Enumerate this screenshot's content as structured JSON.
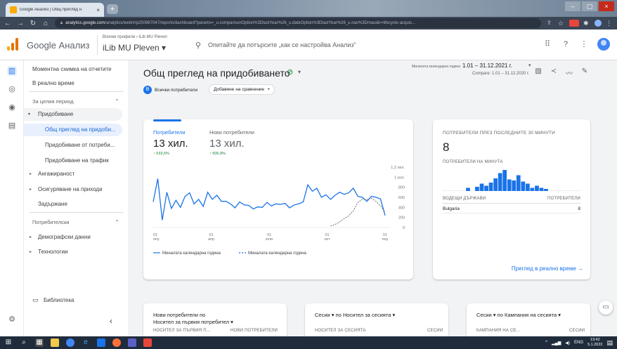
{
  "browser": {
    "tab_title": "Google Анализ | Общ преглед н",
    "tab_close": "×",
    "new_tab": "+",
    "url_host": "analytics.google.com",
    "url_path": "/analytics/web/#/p250987047/reports/dashboard?params=_u.comparisonOption%3DlastYear%26_u.dateOption%3DlastYear%26_u.nav%3Dmaui&r=lifecycle-acquis..."
  },
  "header": {
    "product_name": "Google Анализ",
    "account_breadcrumb": "Всички профили › iLib MU Pleven",
    "property_name": "iLib MU Pleven ▾",
    "search_placeholder": "Опитайте да потърсите „как се настройва Анализ\""
  },
  "sidenav": {
    "snapshot": "Моментна снимка на отчетите",
    "realtime": "В реално време",
    "lifecycle_section": "За целия период",
    "acquisition": "Придобиване",
    "acq_overview": "Общ преглед на придоби...",
    "acq_user": "Придобиване от потреби...",
    "acq_traffic": "Придобиване на трафик",
    "engagement": "Ангажираност",
    "monetization": "Осигуряване на приходи",
    "retention": "Задържане",
    "user_section": "Потребителски",
    "demographics": "Демографски данни",
    "tech": "Технологии",
    "library": "Библиотека"
  },
  "main": {
    "title": "Общ преглед на придобиването",
    "date_label": "Миналата календарна година",
    "date_range": "1.01 – 31.12.2021 г.",
    "date_compare": "Compare: 1.01 – 31.12.2020 г.",
    "chip_all_letter": "В",
    "chip_all": "Всички потребители",
    "chip_add": "Добавяне на сравнение",
    "chip_add_icon": "+"
  },
  "metrics": [
    {
      "label": "Потребители",
      "value": "13 хил.",
      "delta": "↑ 533,5%"
    },
    {
      "label": "Нови потребители",
      "value": "13 хил.",
      "delta": "↑ 506,9%"
    }
  ],
  "chart_data": {
    "type": "line",
    "x_tick_labels": [
      "01\nяну",
      "01\nапр",
      "01\nюли",
      "01\nокт",
      "01\nяну"
    ],
    "y_tick_labels": [
      "1,2 хил.",
      "1 хил.",
      "800",
      "600",
      "400",
      "200",
      "0"
    ],
    "ylim": [
      0,
      1200
    ],
    "series": [
      {
        "name": "Миналата календарна година",
        "style": "solid",
        "color": "#1a73e8",
        "values": [
          510,
          970,
          150,
          700,
          380,
          540,
          400,
          620,
          690,
          470,
          560,
          420,
          700,
          560,
          640,
          520,
          520,
          470,
          390,
          510,
          450,
          440,
          370,
          410,
          400,
          500,
          430,
          470,
          460,
          480,
          390,
          450,
          470,
          510,
          850,
          720,
          780,
          600,
          650,
          560,
          640,
          700,
          660,
          690,
          780,
          620,
          600,
          520,
          620,
          600,
          570,
          240
        ]
      },
      {
        "name": "Миналата календарна година",
        "style": "dashed",
        "color": "#1a73e8",
        "values": [
          null,
          null,
          null,
          null,
          null,
          null,
          null,
          null,
          null,
          null,
          null,
          null,
          null,
          null,
          null,
          null,
          null,
          null,
          null,
          null,
          null,
          null,
          null,
          null,
          null,
          null,
          null,
          null,
          null,
          null,
          null,
          null,
          null,
          null,
          null,
          null,
          null,
          null,
          null,
          30,
          60,
          110,
          180,
          230,
          330,
          500,
          560,
          560,
          580,
          520,
          430,
          310
        ]
      }
    ]
  },
  "realtime": {
    "title": "ПОТРЕБИТЕЛИ ПРЕЗ ПОСЛЕДНИТЕ 30 МИНУТИ",
    "value": "8",
    "per_minute": "ПОТРЕБИТЕЛИ НА МИНУТА",
    "col_country": "ВОДЕЩИ ДЪРЖАВИ",
    "col_users": "ПОТРЕБИТЕЛИ",
    "country": "Bulgaria",
    "count": "8",
    "link": "Преглед в реално време →",
    "bars": [
      0,
      0,
      0,
      0,
      0,
      0.15,
      0,
      0.2,
      0.35,
      0.25,
      0.4,
      0.6,
      0.85,
      1,
      0.55,
      0.5,
      0.75,
      0.45,
      0.35,
      0.15,
      0.25,
      0.15,
      0.1,
      0,
      0,
      0,
      0,
      0,
      0,
      0
    ]
  },
  "bottom_cards": [
    {
      "title": "Нови потребители по",
      "subtitle": "Носител за първия потребител ▾",
      "col1": "НОСИТЕЛ ЗА ПЪРВИЯ П...",
      "col2": "НОВИ ПОТРЕБИТЕЛИ"
    },
    {
      "title": "Сесии ▾  по Носител за сесията ▾",
      "col1": "НОСИТЕЛ ЗА СЕСИЯТА",
      "col2": "СЕСИИ"
    },
    {
      "title": "Сесии ▾  по Кампания на сесията ▾",
      "col1": "КАМПАНИЯ НА СЕ...",
      "col2": "СЕСИИ"
    }
  ],
  "taskbar": {
    "lang": "ENG",
    "time": "13:42",
    "date": "5.1.2022"
  },
  "colors": {
    "primary": "#1a73e8",
    "positive": "#188038",
    "line_dash": "#5f6368"
  }
}
